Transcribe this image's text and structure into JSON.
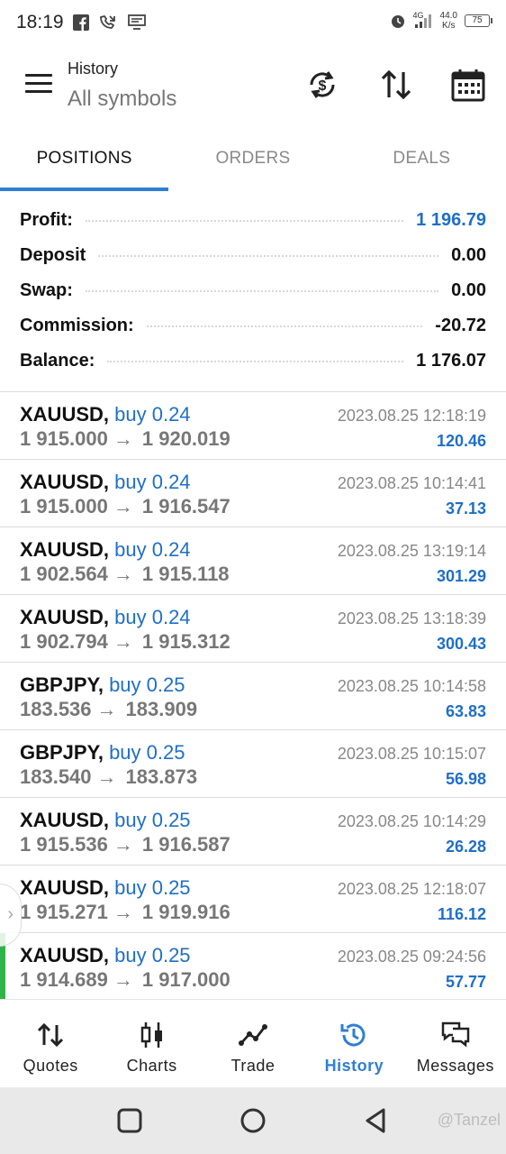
{
  "status_bar": {
    "time": "18:19",
    "network_label": "4G",
    "net_speed_value": "44.0",
    "net_speed_unit": "K/s",
    "battery": "75"
  },
  "header": {
    "title": "History",
    "subtitle": "All symbols"
  },
  "tabs": [
    {
      "label": "POSITIONS",
      "active": true
    },
    {
      "label": "ORDERS",
      "active": false
    },
    {
      "label": "DEALS",
      "active": false
    }
  ],
  "summary": [
    {
      "label": "Profit:",
      "value": "1 196.79",
      "highlight": true
    },
    {
      "label": "Deposit",
      "value": "0.00",
      "highlight": false
    },
    {
      "label": "Swap:",
      "value": "0.00",
      "highlight": false
    },
    {
      "label": "Commission:",
      "value": "-20.72",
      "highlight": false
    },
    {
      "label": "Balance:",
      "value": "1 176.07",
      "highlight": false
    }
  ],
  "positions": [
    {
      "symbol": "XAUUSD,",
      "side": "buy 0.24",
      "open": "1 915.000",
      "close": "1 920.019",
      "arrow": "→",
      "date": "2023.08.25 12:18:19",
      "profit": "120.46"
    },
    {
      "symbol": "XAUUSD,",
      "side": "buy 0.24",
      "open": "1 915.000",
      "close": "1 916.547",
      "arrow": "→",
      "date": "2023.08.25 10:14:41",
      "profit": "37.13"
    },
    {
      "symbol": "XAUUSD,",
      "side": "buy 0.24",
      "open": "1 902.564",
      "close": "1 915.118",
      "arrow": "→",
      "date": "2023.08.25 13:19:14",
      "profit": "301.29"
    },
    {
      "symbol": "XAUUSD,",
      "side": "buy 0.24",
      "open": "1 902.794",
      "close": "1 915.312",
      "arrow": "→",
      "date": "2023.08.25 13:18:39",
      "profit": "300.43"
    },
    {
      "symbol": "GBPJPY,",
      "side": "buy 0.25",
      "open": "183.536",
      "close": "183.909",
      "arrow": "→",
      "date": "2023.08.25 10:14:58",
      "profit": "63.83"
    },
    {
      "symbol": "GBPJPY,",
      "side": "buy 0.25",
      "open": "183.540",
      "close": "183.873",
      "arrow": "→",
      "date": "2023.08.25 10:15:07",
      "profit": "56.98"
    },
    {
      "symbol": "XAUUSD,",
      "side": "buy 0.25",
      "open": "1 915.536",
      "close": "1 916.587",
      "arrow": "→",
      "date": "2023.08.25 10:14:29",
      "profit": "26.28"
    },
    {
      "symbol": "XAUUSD,",
      "side": "buy 0.25",
      "open": "1 915.271",
      "close": "1 919.916",
      "arrow": "→",
      "date": "2023.08.25 12:18:07",
      "profit": "116.12"
    },
    {
      "symbol": "XAUUSD,",
      "side": "buy 0.25",
      "open": "1 914.689",
      "close": "1 917.000",
      "arrow": "→",
      "date": "2023.08.25 09:24:56",
      "profit": "57.77"
    }
  ],
  "bottom_nav": [
    {
      "label": "Quotes",
      "icon": "quotes-icon",
      "active": false
    },
    {
      "label": "Charts",
      "icon": "charts-icon",
      "active": false
    },
    {
      "label": "Trade",
      "icon": "trade-icon",
      "active": false
    },
    {
      "label": "History",
      "icon": "history-icon",
      "active": true
    },
    {
      "label": "Messages",
      "icon": "messages-icon",
      "active": false
    }
  ],
  "watermark": "@Tanzel",
  "colors": {
    "accent_blue": "#2f7fd2",
    "profit_blue": "#1e6fc9",
    "open_position_green": "#2fb34a",
    "muted_gray": "#777777"
  }
}
